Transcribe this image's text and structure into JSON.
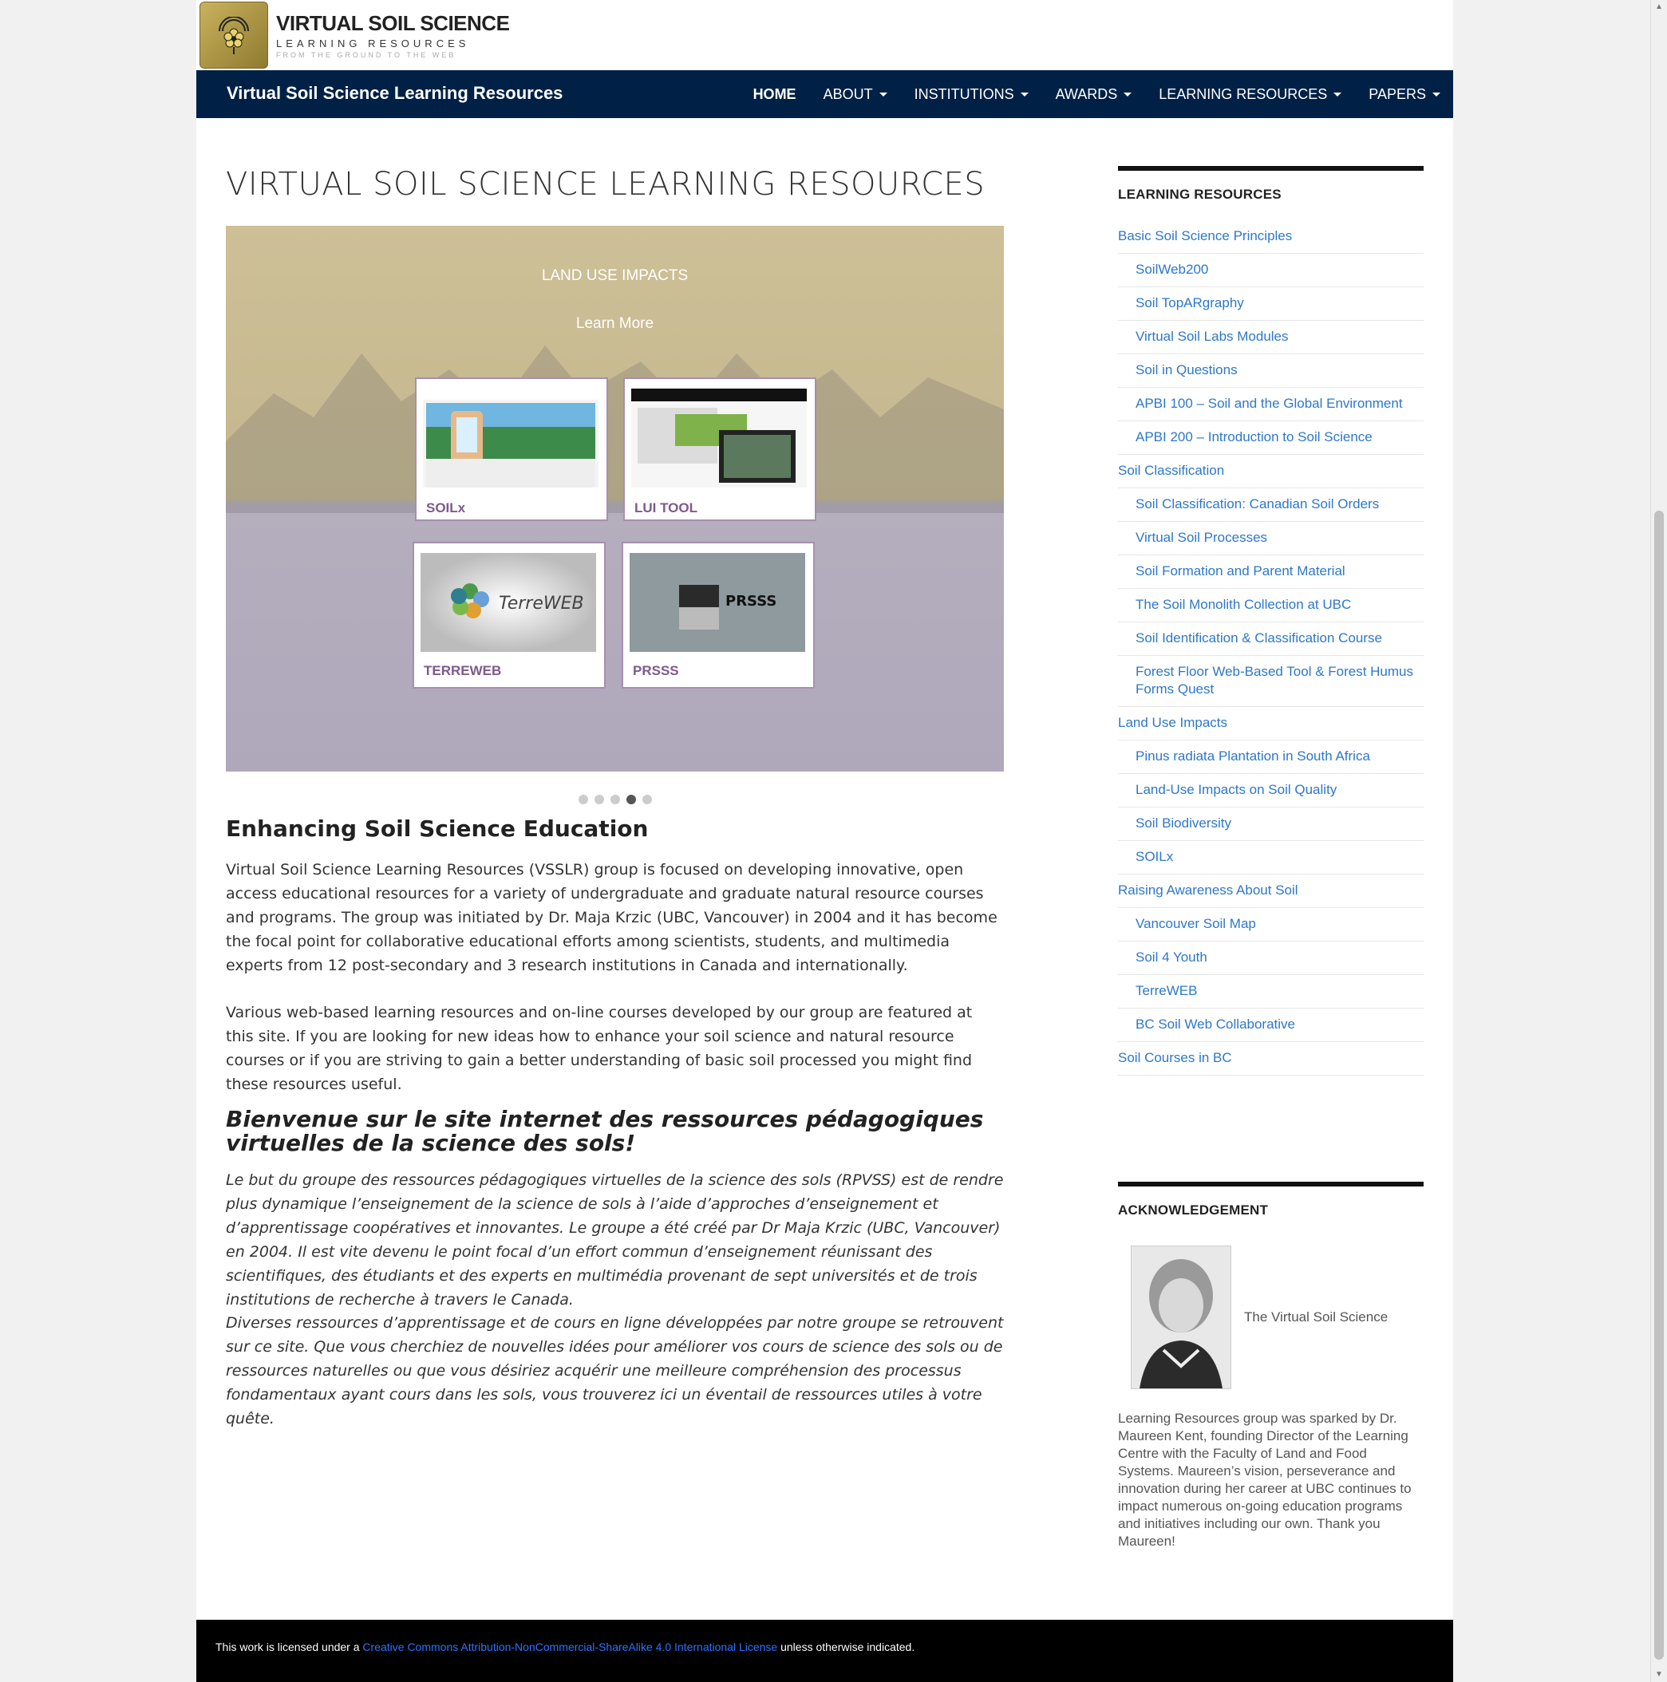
{
  "header": {
    "brand_line1": "VIRTUAL SOIL SCIENCE",
    "brand_line2": "LEARNING RESOURCES",
    "brand_line3": "FROM THE GROUND TO THE WEB"
  },
  "nav": {
    "site_title": "Virtual Soil Science Learning Resources",
    "items": [
      {
        "label": "HOME"
      },
      {
        "label": "ABOUT"
      },
      {
        "label": "INSTITUTIONS"
      },
      {
        "label": "AWARDS"
      },
      {
        "label": "LEARNING RESOURCES"
      },
      {
        "label": "PAPERS"
      }
    ]
  },
  "main": {
    "page_title": "VIRTUAL SOIL SCIENCE LEARNING RESOURCES",
    "slider": {
      "title": "LAND USE IMPACTS",
      "learn_more": "Learn More",
      "cards": [
        {
          "label": "SOILx"
        },
        {
          "label": "LUI TOOL"
        },
        {
          "label": "TERREWEB"
        },
        {
          "label": "PRSSS"
        }
      ],
      "active_dot": 4,
      "dot_count": 5
    },
    "heading_en": "Enhancing Soil Science Education",
    "para1": "Virtual Soil Science Learning Resources (VSSLR) group is focused on developing innovative, open access educational resources for a variety of undergraduate and graduate natural resource courses and programs. The group was initiated by Dr. Maja Krzic (UBC, Vancouver) in 2004 and it has become the focal point for collaborative educational efforts among scientists, students, and multimedia experts from 12 post-secondary and 3 research institutions in Canada and internationally.",
    "para2": "Various web-based learning resources and on-line courses developed by our group are featured at this site. If you are looking for new ideas how to enhance your soil science and natural resource courses or if you are striving to gain a better understanding of basic soil processed you might find these resources useful.",
    "heading_fr": "Bienvenue sur le site internet des ressources pédagogiques virtuelles de la science des sols!",
    "para3": "Le but du groupe des ressources pédagogiques virtuelles de la science des sols (RPVSS) est de rendre plus dynamique l’enseignement de la science de sols à l’aide d’approches d’enseignement et d’apprentissage coopératives et innovantes. Le groupe a été créé par Dr Maja Krzic (UBC, Vancouver) en 2004. Il est vite devenu le point focal d’un effort commun d’enseignement réunissant des scientifiques, des étudiants et des experts en multimédia provenant de sept universités et de trois institutions de recherche à travers le Canada.",
    "para4": "Diverses ressources d’apprentissage et de cours en ligne développées par notre groupe se retrouvent sur ce site. Que vous cherchiez de nouvelles idées pour améliorer vos cours de science des sols ou de ressources naturelles ou que vous désiriez acquérir une meilleure compréhension des processus fondamentaux ayant cours dans les sols, vous trouverez ici un éventail de ressources utiles à votre quête."
  },
  "sidebar": {
    "lr_title": "LEARNING RESOURCES",
    "links": [
      {
        "label": "Basic Soil Science Principles",
        "sub": false
      },
      {
        "label": "SoilWeb200",
        "sub": true
      },
      {
        "label": "Soil TopARgraphy",
        "sub": true
      },
      {
        "label": "Virtual Soil Labs Modules",
        "sub": true
      },
      {
        "label": "Soil in Questions",
        "sub": true
      },
      {
        "label": "APBI 100 – Soil and the Global Environment",
        "sub": true
      },
      {
        "label": "APBI 200 – Introduction to Soil Science",
        "sub": true
      },
      {
        "label": "Soil Classification",
        "sub": false
      },
      {
        "label": "Soil Classification: Canadian Soil Orders",
        "sub": true
      },
      {
        "label": "Virtual Soil Processes",
        "sub": true
      },
      {
        "label": "Soil Formation and Parent Material",
        "sub": true
      },
      {
        "label": "The Soil Monolith Collection at UBC",
        "sub": true
      },
      {
        "label": "Soil Identification & Classification Course",
        "sub": true
      },
      {
        "label": "Forest Floor Web-Based Tool & Forest Humus Forms Quest",
        "sub": true
      },
      {
        "label": "Land Use Impacts",
        "sub": false
      },
      {
        "label": "Pinus radiata Plantation in South Africa",
        "sub": true
      },
      {
        "label": "Land-Use Impacts on Soil Quality",
        "sub": true
      },
      {
        "label": "Soil Biodiversity",
        "sub": true
      },
      {
        "label": "SOILx",
        "sub": true
      },
      {
        "label": "Raising Awareness About Soil",
        "sub": false
      },
      {
        "label": "Vancouver Soil Map",
        "sub": true
      },
      {
        "label": "Soil 4 Youth",
        "sub": true
      },
      {
        "label": "TerreWEB",
        "sub": true
      },
      {
        "label": "BC Soil Web Collaborative",
        "sub": true
      },
      {
        "label": "Soil Courses in BC",
        "sub": false
      }
    ],
    "ack_title": "ACKNOWLEDGEMENT",
    "ack_caption": "The Virtual Soil Science",
    "ack_text": "Learning Resources group was sparked by Dr. Maureen Kent, founding Director of the Learning Centre with the Faculty of Land and Food Systems. Maureen’s vision, perseverance and innovation during her career at UBC continues to impact numerous on-going education programs and initiatives including our own. Thank you Maureen!"
  },
  "footer": {
    "prefix": "This work is licensed under a ",
    "link": "Creative Commons Attribution-NonCommercial-ShareAlike 4.0 International License",
    "suffix": " unless otherwise indicated."
  },
  "colors": {
    "nav_bg": "#002145",
    "link": "#2d78c9",
    "card_label": "#7d5a8d",
    "footer_link": "#2a73ff"
  }
}
